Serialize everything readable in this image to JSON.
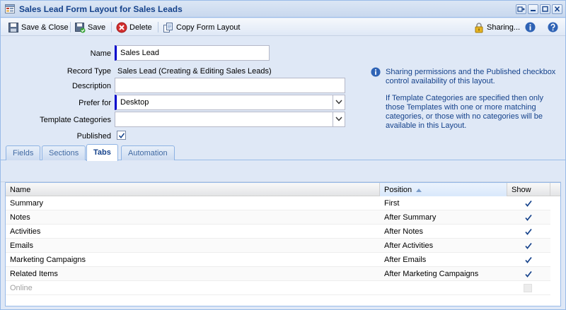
{
  "window": {
    "title": "Sales Lead Form Layout for Sales Leads"
  },
  "toolbar": {
    "save_close_label": "Save & Close",
    "save_label": "Save",
    "delete_label": "Delete",
    "copy_label": "Copy Form Layout",
    "sharing_label": "Sharing..."
  },
  "form": {
    "name_label": "Name",
    "name_value": "Sales Lead",
    "record_type_label": "Record Type",
    "record_type_value": "Sales Lead (Creating & Editing Sales Leads)",
    "description_label": "Description",
    "description_value": "",
    "prefer_for_label": "Prefer for",
    "prefer_for_value": "Desktop",
    "template_categories_label": "Template Categories",
    "template_categories_value": "",
    "published_label": "Published",
    "published_checked": true
  },
  "info": {
    "paragraph1": "Sharing permissions and the Published checkbox control availability of this layout.",
    "paragraph2": "If Template Categories are specified then only those Templates with one or more matching categories, or those with no categories will be available in this Layout."
  },
  "tabs": [
    {
      "label": "Fields",
      "active": false
    },
    {
      "label": "Sections",
      "active": false
    },
    {
      "label": "Tabs",
      "active": true
    },
    {
      "label": "Automation",
      "active": false
    }
  ],
  "grid": {
    "columns": {
      "name": "Name",
      "position": "Position",
      "show": "Show"
    },
    "sort_column": "position",
    "sort_direction": "asc",
    "rows": [
      {
        "name": "Summary",
        "position": "First",
        "show": true
      },
      {
        "name": "Notes",
        "position": "After Summary",
        "show": true
      },
      {
        "name": "Activities",
        "position": "After Notes",
        "show": true
      },
      {
        "name": "Emails",
        "position": "After Activities",
        "show": true
      },
      {
        "name": "Marketing Campaigns",
        "position": "After Emails",
        "show": true
      },
      {
        "name": "Related Items",
        "position": "After Marketing Campaigns",
        "show": true
      },
      {
        "name": "Online",
        "position": "",
        "show": false,
        "disabled": true
      }
    ]
  },
  "colors": {
    "title_text": "#15428b",
    "required_marker": "#0000cc",
    "panel_bg": "#dfe8f6",
    "border": "#99bbe8",
    "check": "#15428b"
  },
  "icons": {
    "title": "form-layout-icon",
    "save_close": "save-close-icon",
    "save": "save-icon",
    "delete": "delete-icon",
    "copy": "copy-icon",
    "sharing": "lock-icon",
    "info": "info-icon",
    "help": "help-icon"
  }
}
